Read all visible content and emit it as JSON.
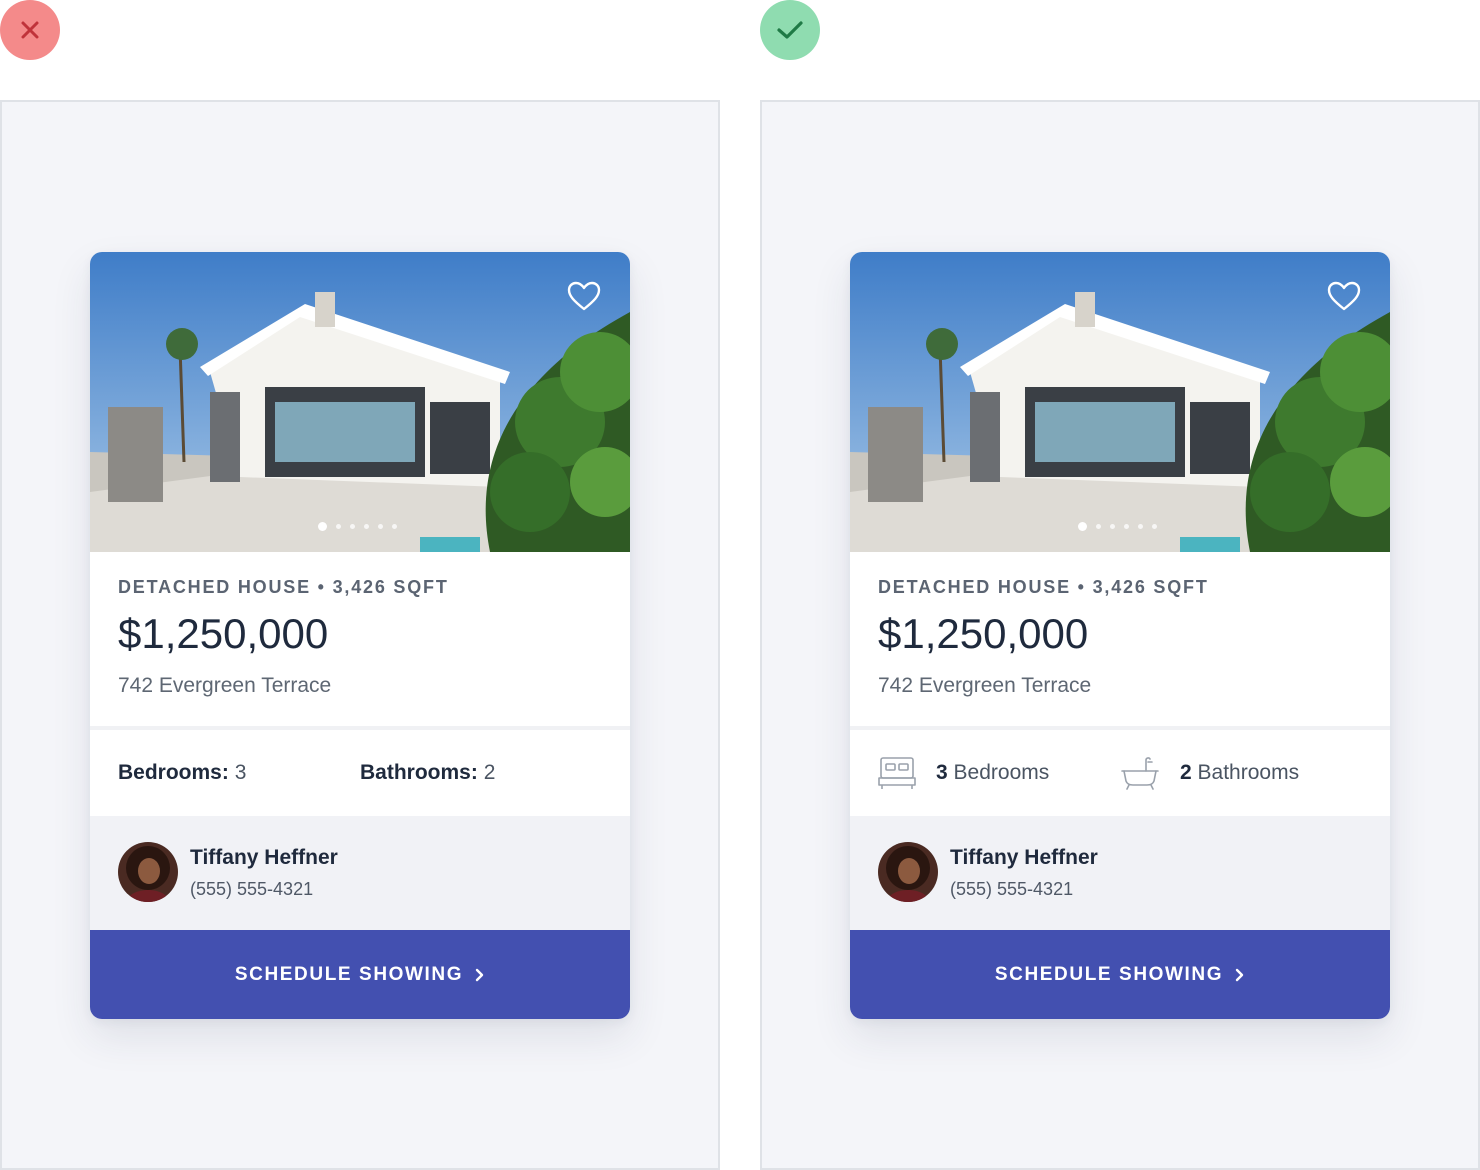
{
  "comparison": {
    "bad_label_icon": "x-icon",
    "good_label_icon": "check-icon",
    "colors": {
      "bad": "#f48a8a",
      "bad_mark": "#c0333a",
      "good": "#8fdcb0",
      "good_mark": "#1f7a46"
    }
  },
  "listing": {
    "kicker": "DETACHED HOUSE • 3,426 SQFT",
    "price": "$1,250,000",
    "address": "742 Evergreen Terrace",
    "photo_icon": "house-photo",
    "favorite_icon": "heart-icon",
    "carousel": {
      "count": 6,
      "active_index": 0
    }
  },
  "bad_variant": {
    "bedrooms_label": "Bedrooms:",
    "bedrooms_value": "3",
    "bathrooms_label": "Bathrooms:",
    "bathrooms_value": "2"
  },
  "good_variant": {
    "bedrooms_count": "3",
    "bedrooms_text": "Bedrooms",
    "bedrooms_icon": "bed-icon",
    "bathrooms_count": "2",
    "bathrooms_text": "Bathrooms",
    "bathrooms_icon": "bathtub-icon"
  },
  "agent": {
    "name": "Tiffany Heffner",
    "phone": "(555) 555-4321",
    "avatar_icon": "avatar"
  },
  "cta": {
    "label": "SCHEDULE SHOWING",
    "icon": "chevron-right-icon",
    "color": "#4350b0"
  }
}
